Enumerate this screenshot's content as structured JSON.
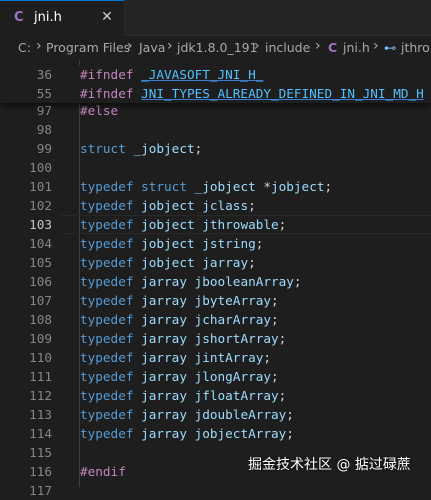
{
  "tab": {
    "icon": "c-file-icon",
    "icon_glyph": "C",
    "name": "jni.h",
    "close_glyph": "✕"
  },
  "breadcrumb": {
    "parts": [
      "C:",
      "Program Files",
      "Java",
      "jdk1.8.0_191",
      "include"
    ],
    "file_glyph": "C",
    "file": "jni.h",
    "symbol_glyph": "⊷",
    "symbol": "jthro",
    "separator": "›"
  },
  "sticky_lines": [
    {
      "num": "36",
      "tokens": [
        [
          "kw",
          "#ifndef"
        ],
        [
          "pun",
          " "
        ],
        [
          "mac",
          "_JAVASOFT_JNI_H_"
        ]
      ]
    },
    {
      "num": "55",
      "tokens": [
        [
          "kw",
          "#ifndef"
        ],
        [
          "pun",
          " "
        ],
        [
          "mac",
          "JNI_TYPES_ALREADY_DEFINED_IN_JNI_MD_H"
        ]
      ]
    }
  ],
  "lines": [
    {
      "num": "97",
      "tokens": [
        [
          "kw",
          "#else"
        ]
      ]
    },
    {
      "num": "98",
      "tokens": []
    },
    {
      "num": "99",
      "tokens": [
        [
          "ty",
          "struct"
        ],
        [
          "pun",
          " "
        ],
        [
          "id",
          "_jobject"
        ],
        [
          "pun",
          ";"
        ]
      ]
    },
    {
      "num": "100",
      "tokens": []
    },
    {
      "num": "101",
      "tokens": [
        [
          "ty",
          "typedef"
        ],
        [
          "pun",
          " "
        ],
        [
          "ty",
          "struct"
        ],
        [
          "pun",
          " "
        ],
        [
          "id",
          "_jobject"
        ],
        [
          "pun",
          " *"
        ],
        [
          "id",
          "jobject"
        ],
        [
          "pun",
          ";"
        ]
      ]
    },
    {
      "num": "102",
      "tokens": [
        [
          "ty",
          "typedef"
        ],
        [
          "pun",
          " "
        ],
        [
          "id",
          "jobject"
        ],
        [
          "pun",
          " "
        ],
        [
          "id",
          "jclass"
        ],
        [
          "pun",
          ";"
        ]
      ]
    },
    {
      "num": "103",
      "active": true,
      "tokens": [
        [
          "ty",
          "typedef"
        ],
        [
          "pun",
          " "
        ],
        [
          "id",
          "jobject"
        ],
        [
          "pun",
          " "
        ],
        [
          "id",
          "jthrowable"
        ],
        [
          "pun",
          ";"
        ]
      ]
    },
    {
      "num": "104",
      "tokens": [
        [
          "ty",
          "typedef"
        ],
        [
          "pun",
          " "
        ],
        [
          "id",
          "jobject"
        ],
        [
          "pun",
          " "
        ],
        [
          "id",
          "jstring"
        ],
        [
          "pun",
          ";"
        ]
      ]
    },
    {
      "num": "105",
      "tokens": [
        [
          "ty",
          "typedef"
        ],
        [
          "pun",
          " "
        ],
        [
          "id",
          "jobject"
        ],
        [
          "pun",
          " "
        ],
        [
          "id",
          "jarray"
        ],
        [
          "pun",
          ";"
        ]
      ]
    },
    {
      "num": "106",
      "tokens": [
        [
          "ty",
          "typedef"
        ],
        [
          "pun",
          " "
        ],
        [
          "id",
          "jarray"
        ],
        [
          "pun",
          " "
        ],
        [
          "id",
          "jbooleanArray"
        ],
        [
          "pun",
          ";"
        ]
      ]
    },
    {
      "num": "107",
      "tokens": [
        [
          "ty",
          "typedef"
        ],
        [
          "pun",
          " "
        ],
        [
          "id",
          "jarray"
        ],
        [
          "pun",
          " "
        ],
        [
          "id",
          "jbyteArray"
        ],
        [
          "pun",
          ";"
        ]
      ]
    },
    {
      "num": "108",
      "tokens": [
        [
          "ty",
          "typedef"
        ],
        [
          "pun",
          " "
        ],
        [
          "id",
          "jarray"
        ],
        [
          "pun",
          " "
        ],
        [
          "id",
          "jcharArray"
        ],
        [
          "pun",
          ";"
        ]
      ]
    },
    {
      "num": "109",
      "tokens": [
        [
          "ty",
          "typedef"
        ],
        [
          "pun",
          " "
        ],
        [
          "id",
          "jarray"
        ],
        [
          "pun",
          " "
        ],
        [
          "id",
          "jshortArray"
        ],
        [
          "pun",
          ";"
        ]
      ]
    },
    {
      "num": "110",
      "tokens": [
        [
          "ty",
          "typedef"
        ],
        [
          "pun",
          " "
        ],
        [
          "id",
          "jarray"
        ],
        [
          "pun",
          " "
        ],
        [
          "id",
          "jintArray"
        ],
        [
          "pun",
          ";"
        ]
      ]
    },
    {
      "num": "111",
      "tokens": [
        [
          "ty",
          "typedef"
        ],
        [
          "pun",
          " "
        ],
        [
          "id",
          "jarray"
        ],
        [
          "pun",
          " "
        ],
        [
          "id",
          "jlongArray"
        ],
        [
          "pun",
          ";"
        ]
      ]
    },
    {
      "num": "112",
      "tokens": [
        [
          "ty",
          "typedef"
        ],
        [
          "pun",
          " "
        ],
        [
          "id",
          "jarray"
        ],
        [
          "pun",
          " "
        ],
        [
          "id",
          "jfloatArray"
        ],
        [
          "pun",
          ";"
        ]
      ]
    },
    {
      "num": "113",
      "tokens": [
        [
          "ty",
          "typedef"
        ],
        [
          "pun",
          " "
        ],
        [
          "id",
          "jarray"
        ],
        [
          "pun",
          " "
        ],
        [
          "id",
          "jdoubleArray"
        ],
        [
          "pun",
          ";"
        ]
      ]
    },
    {
      "num": "114",
      "tokens": [
        [
          "ty",
          "typedef"
        ],
        [
          "pun",
          " "
        ],
        [
          "id",
          "jarray"
        ],
        [
          "pun",
          " "
        ],
        [
          "id",
          "jobjectArray"
        ],
        [
          "pun",
          ";"
        ]
      ]
    },
    {
      "num": "115",
      "tokens": []
    },
    {
      "num": "116",
      "tokens": [
        [
          "kw",
          "#endif"
        ]
      ]
    },
    {
      "num": "117",
      "tokens": []
    }
  ],
  "watermark": "掘金技术社区 @ 掂过碌蔗",
  "colors": {
    "accent": "#0078d4",
    "keyword": "#c586c0",
    "type": "#569cd6",
    "identifier": "#9cdcfe",
    "macro": "#4fc1ff"
  }
}
